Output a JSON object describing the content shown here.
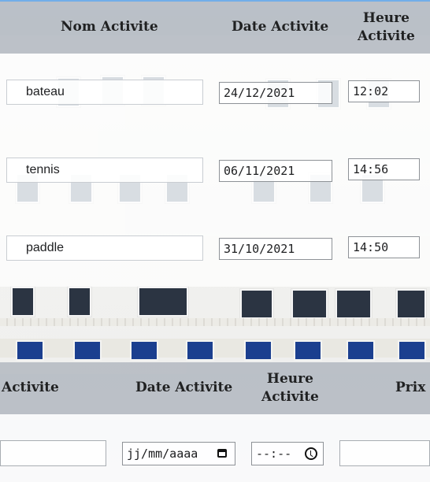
{
  "table_top": {
    "headers": {
      "name": "Nom Activite",
      "date": "Date Activite",
      "time_line1": "Heure",
      "time_line2": "Activite"
    },
    "rows": [
      {
        "name": "bateau",
        "date": "24/12/2021",
        "time": "12:02"
      },
      {
        "name": "tennis",
        "date": "06/11/2021",
        "time": "14:56"
      },
      {
        "name": "paddle",
        "date": "31/10/2021",
        "time": "14:50"
      }
    ]
  },
  "table_bottom": {
    "headers": {
      "name_partial": "Activite",
      "date": "Date Activite",
      "time_line1": "Heure",
      "time_line2": "Activite",
      "price_partial": "Prix A"
    },
    "new_row": {
      "date_placeholder": "jj/mm/aaaa",
      "time_placeholder": "--:--"
    }
  },
  "icons": {
    "calendar": "calendar-icon",
    "clock": "clock-icon"
  }
}
